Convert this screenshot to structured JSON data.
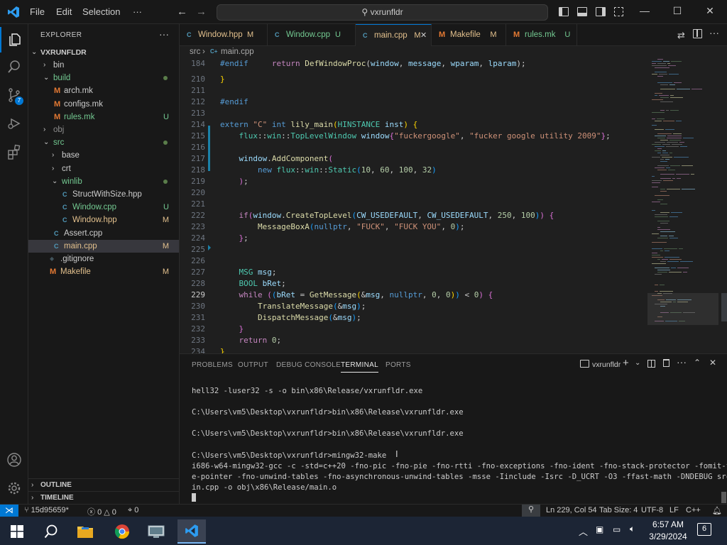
{
  "titlebar": {
    "menus": [
      "File",
      "Edit",
      "Selection",
      "···"
    ],
    "search": "vxrunfldr",
    "win_controls": [
      "—",
      "☐",
      "✕"
    ]
  },
  "activity": {
    "scm_badge": "7"
  },
  "explorer": {
    "header": "EXPLORER",
    "more": "···",
    "root": "VXRUNFLDR",
    "items": [
      {
        "label": "bin",
        "type": "folder",
        "open": false,
        "depth": 1,
        "color": "#cccccc",
        "dec": ""
      },
      {
        "label": "build",
        "type": "folder",
        "open": true,
        "depth": 1,
        "color": "#73c991",
        "dec": "dot"
      },
      {
        "label": "arch.mk",
        "type": "mk",
        "depth": 2,
        "color": "#cccccc",
        "dec": ""
      },
      {
        "label": "configs.mk",
        "type": "mk",
        "depth": 2,
        "color": "#cccccc",
        "dec": ""
      },
      {
        "label": "rules.mk",
        "type": "mk",
        "depth": 2,
        "color": "#73c991",
        "dec": "U"
      },
      {
        "label": "obj",
        "type": "folder",
        "open": false,
        "depth": 1,
        "color": "#8c8c8c",
        "dec": ""
      },
      {
        "label": "src",
        "type": "folder",
        "open": true,
        "depth": 1,
        "color": "#73c991",
        "dec": "dot"
      },
      {
        "label": "base",
        "type": "folder",
        "open": false,
        "depth": 2,
        "color": "#cccccc",
        "dec": ""
      },
      {
        "label": "crt",
        "type": "folder",
        "open": false,
        "depth": 2,
        "color": "#cccccc",
        "dec": ""
      },
      {
        "label": "winlib",
        "type": "folder",
        "open": true,
        "depth": 2,
        "color": "#73c991",
        "dec": "dot"
      },
      {
        "label": "StructWithSize.hpp",
        "type": "cpp",
        "depth": 3,
        "color": "#cccccc",
        "dec": ""
      },
      {
        "label": "Window.cpp",
        "type": "cpp",
        "depth": 3,
        "color": "#73c991",
        "dec": "U"
      },
      {
        "label": "Window.hpp",
        "type": "cpp",
        "depth": 3,
        "color": "#e2c08d",
        "dec": "M"
      },
      {
        "label": "Assert.cpp",
        "type": "cpp",
        "depth": 2,
        "color": "#cccccc",
        "dec": ""
      },
      {
        "label": "main.cpp",
        "type": "cpp",
        "depth": 2,
        "color": "#e2c08d",
        "dec": "M",
        "selected": true
      },
      {
        "label": ".gitignore",
        "type": "git",
        "depth": 1,
        "color": "#cccccc",
        "dec": ""
      },
      {
        "label": "Makefile",
        "type": "mk",
        "depth": 1,
        "color": "#e2c08d",
        "dec": "M"
      }
    ],
    "outline": "OUTLINE",
    "timeline": "TIMELINE"
  },
  "tabs": [
    {
      "label": "Window.hpp",
      "dec": "M",
      "color": "#e2c08d",
      "icon": "C"
    },
    {
      "label": "Window.cpp",
      "dec": "U",
      "color": "#73c991",
      "icon": "C"
    },
    {
      "label": "main.cpp",
      "dec": "M",
      "color": "#e2c08d",
      "icon": "C",
      "active": true,
      "close": "✕"
    },
    {
      "label": "Makefile",
      "dec": "M",
      "color": "#e2c08d",
      "icon": "M"
    },
    {
      "label": "rules.mk",
      "dec": "U",
      "color": "#73c991",
      "icon": "M"
    }
  ],
  "breadcrumb": {
    "folder": "src",
    "sep": "›",
    "file": "main.cpp"
  },
  "editor": {
    "line_numbers": [
      "184",
      "210",
      "211",
      "212",
      "213",
      "214",
      "215",
      "216",
      "217",
      "218",
      "219",
      "220",
      "221",
      "222",
      "223",
      "224",
      "225",
      "226",
      "227",
      "228",
      "229",
      "230",
      "231",
      "232",
      "233",
      "234"
    ],
    "current_line": "229"
  },
  "panel": {
    "tabs": [
      "PROBLEMS",
      "OUTPUT",
      "DEBUG CONSOLE",
      "TERMINAL",
      "PORTS"
    ],
    "terminal_name": "vxrunfldr",
    "lines": [
      "hell32 -luser32 -s -o bin\\x86\\Release/vxrunfldr.exe",
      "",
      "C:\\Users\\vm5\\Desktop\\vxrunfldr>bin\\x86\\Release\\vxrunfldr.exe",
      "",
      "C:\\Users\\vm5\\Desktop\\vxrunfldr>bin\\x86\\Release\\vxrunfldr.exe",
      "",
      "C:\\Users\\vm5\\Desktop\\vxrunfldr>mingw32-make",
      "i686-w64-mingw32-gcc -c -std=c++20 -fno-pic -fno-pie -fno-rtti -fno-exceptions -fno-ident -fno-stack-protector -fomit-fram",
      "e-pointer -fno-unwind-tables -fno-asynchronous-unwind-tables -msse -Iinclude -Isrc -D_UCRT -O3 -ffast-math -DNDEBUG src/ma",
      "in.cpp -o obj\\x86\\Release/main.o"
    ]
  },
  "statusbar": {
    "remote": "⋊",
    "branch": "15d95659*",
    "errors": "0",
    "warnings": "0",
    "ports": "0",
    "position": "Ln 229, Col 54",
    "tabsize": "Tab Size: 4",
    "encoding": "UTF-8",
    "eol": "LF",
    "language": "C++"
  },
  "taskbar": {
    "time": "6:57 AM",
    "date": "3/29/2024",
    "notifications": "6"
  }
}
